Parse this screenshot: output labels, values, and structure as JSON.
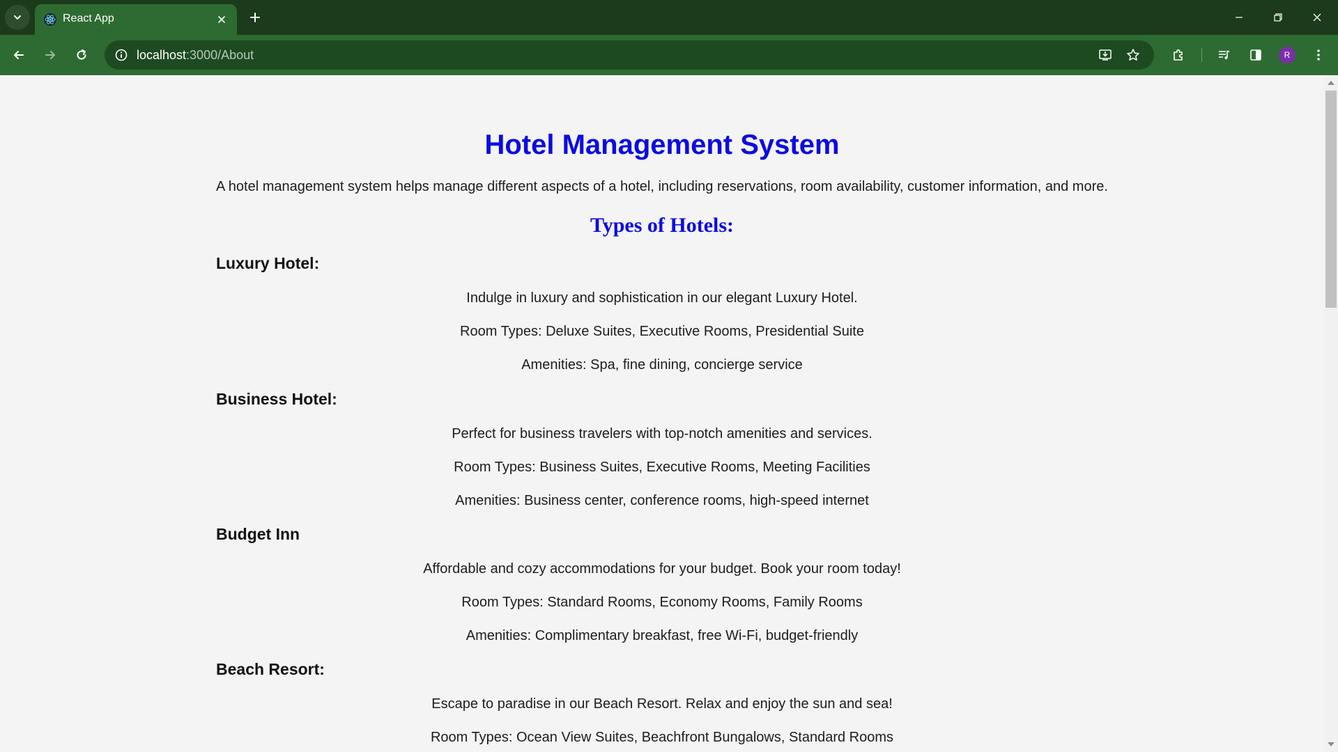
{
  "browser": {
    "tab": {
      "title": "React App",
      "favicon": "react-icon"
    },
    "url": {
      "host": "localhost",
      "path": ":3000/About"
    },
    "profile_initial": "R",
    "colors": {
      "frame": "#1c3a1c",
      "toolbar": "#2e6b32",
      "omnibox": "#1e4a22"
    }
  },
  "page": {
    "title": "Hotel Management System",
    "intro": "A hotel management system helps manage different aspects of a hotel, including reservations, room availability, customer information, and more.",
    "types_heading": "Types of Hotels:",
    "title_color": "#0b0be3",
    "hotels": [
      {
        "name": "Luxury Hotel:",
        "description": "Indulge in luxury and sophistication in our elegant Luxury Hotel.",
        "room_types": "Room Types: Deluxe Suites, Executive Rooms, Presidential Suite",
        "amenities": "Amenities: Spa, fine dining, concierge service"
      },
      {
        "name": "Business Hotel:",
        "description": "Perfect for business travelers with top-notch amenities and services.",
        "room_types": "Room Types: Business Suites, Executive Rooms, Meeting Facilities",
        "amenities": "Amenities: Business center, conference rooms, high-speed internet"
      },
      {
        "name": "Budget Inn",
        "description": "Affordable and cozy accommodations for your budget. Book your room today!",
        "room_types": "Room Types: Standard Rooms, Economy Rooms, Family Rooms",
        "amenities": "Amenities: Complimentary breakfast, free Wi-Fi, budget-friendly"
      },
      {
        "name": "Beach Resort:",
        "description": "Escape to paradise in our Beach Resort. Relax and enjoy the sun and sea!",
        "room_types": "Room Types: Ocean View Suites, Beachfront Bungalows, Standard Rooms"
      }
    ]
  }
}
